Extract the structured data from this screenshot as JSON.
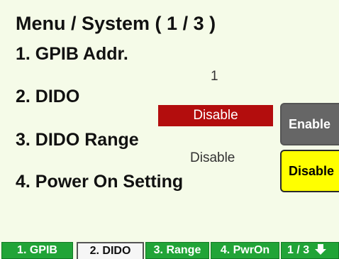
{
  "title": "Menu / System ( 1 / 3 )",
  "items": [
    {
      "label": "1. GPIB Addr.",
      "value": "1"
    },
    {
      "label": "2. DIDO",
      "value": "Disable"
    },
    {
      "label": "3. DIDO Range",
      "value": "Disable"
    },
    {
      "label": "4. Power On Setting",
      "value": ""
    }
  ],
  "side_buttons": {
    "enable": "Enable",
    "disable": "Disable"
  },
  "tabs": [
    {
      "label": "1. GPIB"
    },
    {
      "label": "2. DIDO"
    },
    {
      "label": "3. Range"
    },
    {
      "label": "4. PwrOn"
    },
    {
      "label": "1 / 3",
      "icon": "arrow-down-icon"
    }
  ],
  "colors": {
    "background": "#f5fbe8",
    "selection": "#b30d0d",
    "tab_green": "#21a437",
    "active_button": "#ffff00",
    "inactive_button": "#666666"
  }
}
